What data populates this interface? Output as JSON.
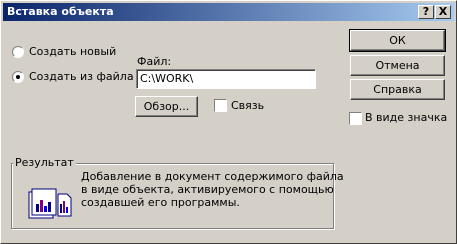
{
  "window": {
    "title": "Вставка объекта",
    "help_btn": "?",
    "close_btn": "X"
  },
  "options": {
    "create_new": "Создать новый",
    "create_from_file": "Создать из файла",
    "selected": "create_from_file"
  },
  "file": {
    "label": "Файл:",
    "value": "C:\\WORK\\"
  },
  "buttons": {
    "browse": "Обзор...",
    "ok": "ОК",
    "cancel": "Отмена",
    "help": "Справка"
  },
  "checkboxes": {
    "link": "Связь",
    "as_icon": "В виде значка"
  },
  "result": {
    "legend": "Результат",
    "line1": "Добавление в документ содержимого файла",
    "line2": "в виде объекта, активируемого с помощью",
    "line3": "создавшей его программы.",
    "icon": "document-chart-icon"
  },
  "colors": {
    "title_start": "#0a246a",
    "title_end": "#a6caf0",
    "face": "#d4d0c8"
  }
}
